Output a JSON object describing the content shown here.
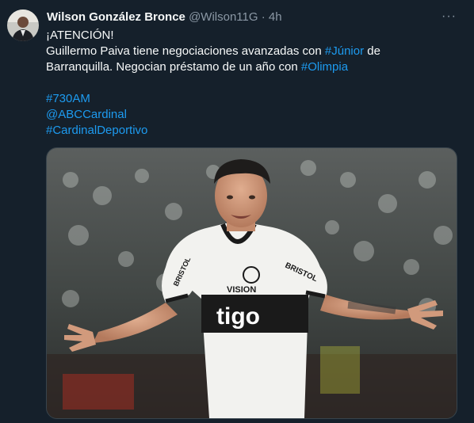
{
  "tweet": {
    "author_name": "Wilson González Bronce",
    "author_handle": "@Wilson11G",
    "separator": "·",
    "time": "4h",
    "more_label": "···",
    "line1": "¡ATENCIÓN!",
    "line2_pre": "Guillermo Paiva tiene negociaciones avanzadas con ",
    "line2_link": "#Júnior",
    "line2_post": " de",
    "line3_pre": "Barranquilla. Negocian préstamo de un año con ",
    "line3_link": "#Olimpia",
    "tag1": "#730AM",
    "tag2": "@ABCCardinal",
    "tag3": "#CardinalDeportivo",
    "shirt_sponsor": "tigo",
    "shirt_vision": "VISION",
    "shirt_bristol": "BRISTOL",
    "shirt_left_sleeve": "BRISTOL"
  },
  "colors": {
    "background": "#15202b",
    "link": "#1d9bf0",
    "muted": "#8b98a5"
  }
}
